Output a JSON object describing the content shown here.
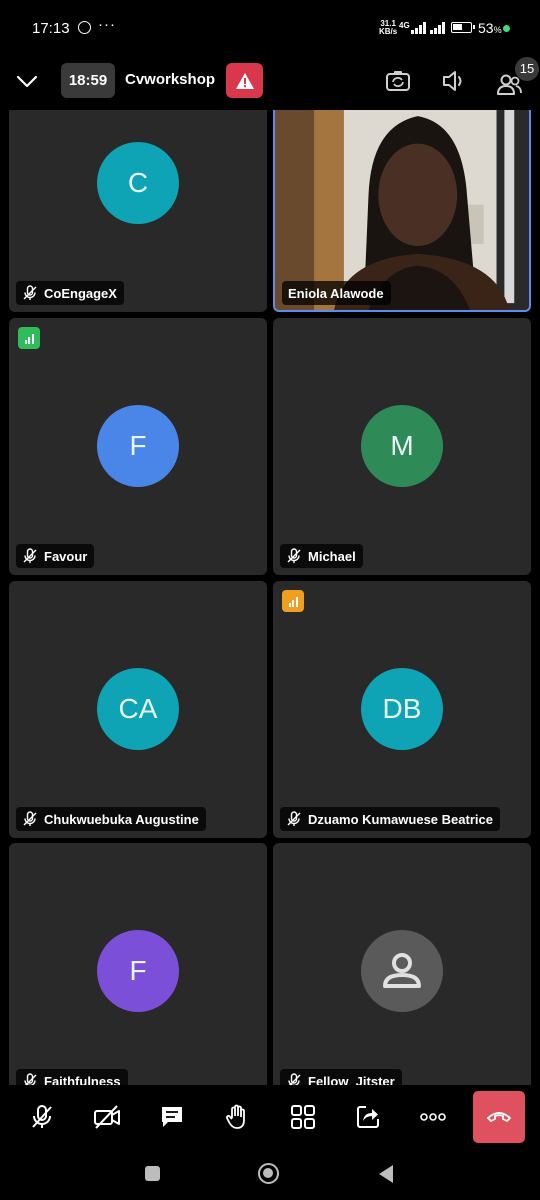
{
  "status_bar": {
    "time": "17:13",
    "dots": "···",
    "net_speed_value": "31.1",
    "net_speed_unit": "KB/s",
    "network_type": "4G",
    "battery": "53",
    "battery_unit": "%",
    "battery_level": 0.53
  },
  "meeting": {
    "timer": "18:59",
    "title": "Cvworkshop",
    "participant_count": "15"
  },
  "participants": [
    {
      "name": "CoEngageX",
      "initials": "C",
      "avatar_color": "#0ea3b5",
      "muted": true
    },
    {
      "name": "Eniola Alawode",
      "video": true,
      "active_speaker": true
    },
    {
      "name": "Favour",
      "initials": "F",
      "avatar_color": "#4a86e8",
      "muted": true,
      "network_quality": "good",
      "network_color": "#2ebd5a"
    },
    {
      "name": "Michael",
      "initials": "M",
      "avatar_color": "#2e8b57",
      "muted": true
    },
    {
      "name": "Chukwuebuka Augustine",
      "initials": "CA",
      "avatar_color": "#0ea3b5",
      "muted": true
    },
    {
      "name": "Dzuamo Kumawuese Beatrice",
      "initials": "DB",
      "avatar_color": "#0ea3b5",
      "muted": true,
      "network_quality": "fair",
      "network_color": "#f0a020"
    },
    {
      "name": "Faithfulness",
      "initials": "F",
      "avatar_color": "#7b4fd8",
      "muted": true
    },
    {
      "name": "Fellow_Jitster",
      "avatar_icon": "person-icon",
      "avatar_color": "#5a5a5a",
      "muted": true
    }
  ],
  "controls": [
    {
      "icon": "mic-off-icon"
    },
    {
      "icon": "camera-off-icon"
    },
    {
      "icon": "chat-icon"
    },
    {
      "icon": "raise-hand-icon"
    },
    {
      "icon": "gallery-view-icon"
    },
    {
      "icon": "share-icon"
    },
    {
      "icon": "more-icon"
    },
    {
      "icon": "leave-call-icon",
      "color": "#e0515f"
    }
  ]
}
